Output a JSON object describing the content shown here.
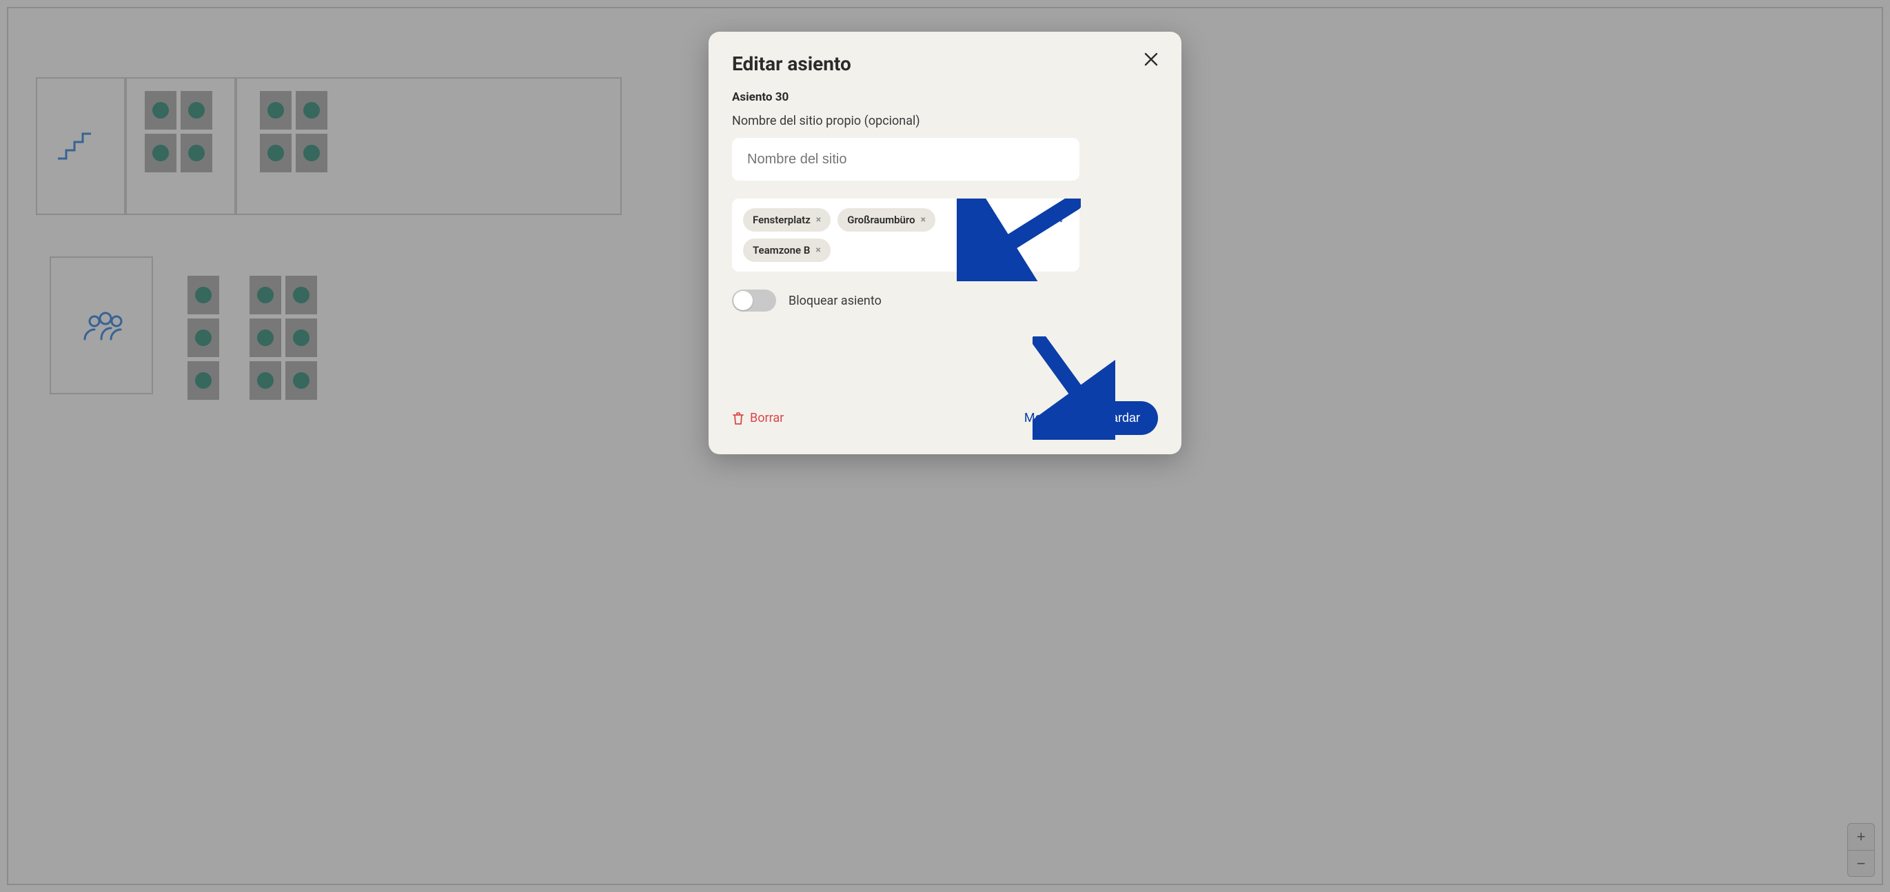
{
  "modal": {
    "title": "Editar asiento",
    "seat_label": "Asiento 30",
    "name_field_label": "Nombre del sitio propio (opcional)",
    "name_placeholder": "Nombre del sitio",
    "tags": [
      "Fensterplatz",
      "Großraumbüro",
      "Teamzone B"
    ],
    "lock_label": "Bloquear asiento",
    "lock_state": false,
    "delete_label": "Borrar",
    "move_label": "Mover",
    "save_label": "Guardar"
  },
  "zoom": {
    "in": "+",
    "out": "−"
  },
  "icons": {
    "close": "×",
    "tag_remove": "×",
    "dropdown": "↓"
  }
}
